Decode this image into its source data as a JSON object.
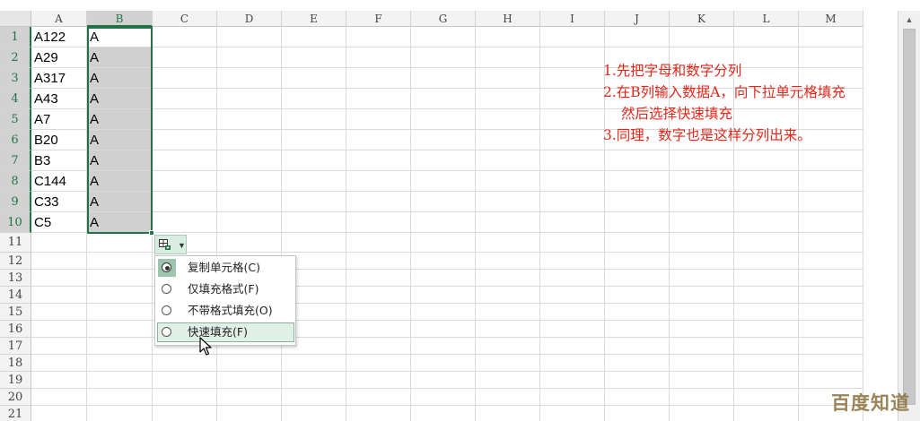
{
  "columns": [
    "A",
    "B",
    "C",
    "D",
    "E",
    "F",
    "G",
    "H",
    "I",
    "J",
    "K",
    "L",
    "M"
  ],
  "selected_column": "B",
  "rows": [
    "1",
    "2",
    "3",
    "4",
    "5",
    "6",
    "7",
    "8",
    "9",
    "10",
    "11",
    "12",
    "13",
    "14",
    "15",
    "16",
    "17",
    "18",
    "19",
    "20",
    "21"
  ],
  "column_a_values": [
    "A122",
    "A29",
    "A317",
    "A43",
    "A7",
    "B20",
    "B3",
    "C144",
    "C33",
    "C5"
  ],
  "column_b_values": [
    "A",
    "A",
    "A",
    "A",
    "A",
    "A",
    "A",
    "A",
    "A",
    "A"
  ],
  "autofill_options": {
    "menu_items": [
      {
        "label": "复制单元格(C)",
        "selected": true
      },
      {
        "label": "仅填充格式(F)",
        "selected": false
      },
      {
        "label": "不带格式填充(O)",
        "selected": false
      },
      {
        "label": "快速填充(F)",
        "selected": false,
        "hovered": true
      }
    ]
  },
  "instructions": [
    "1.先把字母和数字分列",
    "2.在B列输入数据A，向下拉单元格填充",
    "然后选择快速填充",
    "3.同理，数字也是这样分列出来。"
  ],
  "watermark": "百度知道",
  "colors": {
    "excel_green": "#217346",
    "note_red": "#e0281a",
    "selection_fill": "#d0d0d0"
  },
  "icons": {
    "autofill_options": "autofill-options-icon",
    "dropdown": "chevron-down-icon",
    "cursor": "mouse-pointer-icon",
    "scroll_up": "scroll-up-arrow-icon"
  }
}
